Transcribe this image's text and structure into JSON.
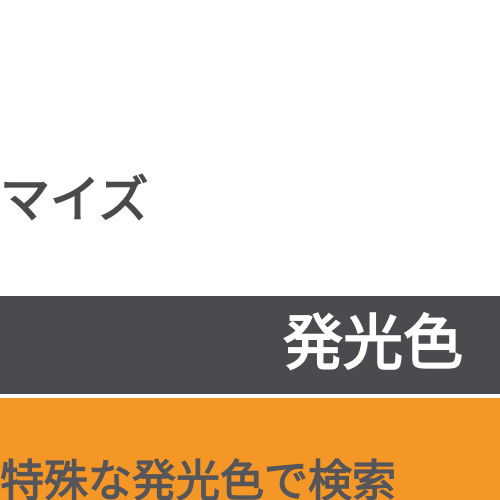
{
  "heading": {
    "text": "マイズ"
  },
  "dark_bar": {
    "text": "発光色",
    "background": "#4b4b4f",
    "text_color": "#ffffff"
  },
  "orange_bar": {
    "text": "特殊な発光色で検索",
    "background": "#f49727",
    "text_color": "#55555a"
  },
  "colors": {
    "page_background": "#ffffff",
    "heading_text": "#4a4a4c"
  }
}
